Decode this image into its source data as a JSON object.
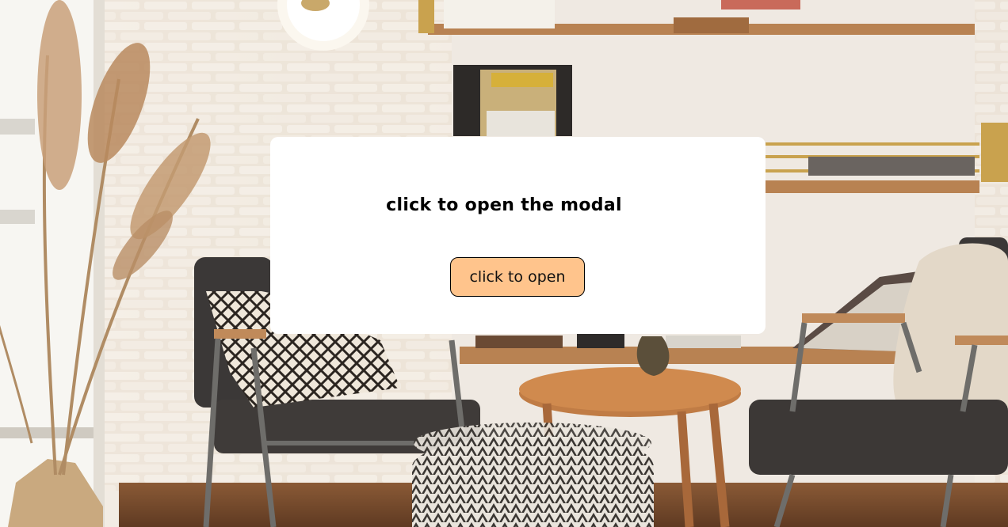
{
  "background": {
    "image": "living-room-photo",
    "colors": {
      "wall": "#efe9e1",
      "brick": "#e7ddd0",
      "shelf_wood": "#b88252",
      "floor": "#7a4a2a"
    }
  },
  "card": {
    "title": "click to open the modal",
    "button_label": "click to open",
    "button_color": "#ffc48c"
  }
}
